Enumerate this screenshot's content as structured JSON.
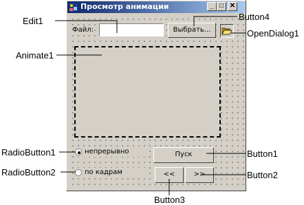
{
  "window": {
    "title": "Просмотр анимации",
    "controls": {
      "minimize": "_",
      "maximize": "□",
      "close": "✕"
    }
  },
  "form": {
    "file_label": "Файл:",
    "file_value": "",
    "choose_button": "Выбрать...",
    "open_icon": "open-folder-icon",
    "radio_continuous": "непрерывно",
    "radio_frames": "по кадрам",
    "radio_selected": "continuous",
    "start_button": "Пуск",
    "prev_button": "<<",
    "next_button": ">>"
  },
  "callouts": {
    "edit1": "Edit1",
    "button4": "Button4",
    "opendialog1": "OpenDialog1",
    "animate1": "Animate1",
    "radiobutton1": "RadioButton1",
    "radiobutton2": "RadioButton2",
    "button1": "Button1",
    "button2": "Button2",
    "button3": "Button3"
  },
  "colors": {
    "window_face": "#d4d0c8",
    "titlebar_start": "#0a246a",
    "titlebar_end": "#a6caf0",
    "callout_line": "#000000"
  }
}
